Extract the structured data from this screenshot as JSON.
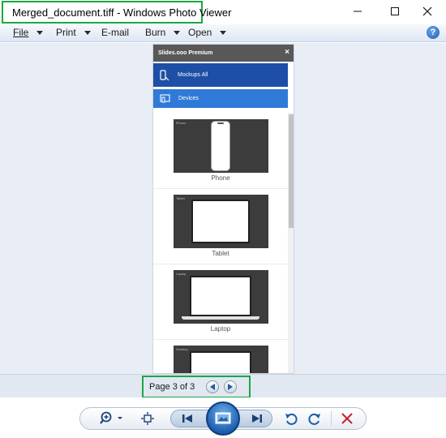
{
  "window": {
    "title": "Merged_document.tiff - Windows Photo Viewer",
    "controls": {
      "minimize_icon": "minimize-icon",
      "maximize_icon": "maximize-icon",
      "close_icon": "close-icon"
    }
  },
  "menu": {
    "items": [
      {
        "label": "File",
        "hotkey_underlined": true,
        "has_dropdown": true
      },
      {
        "label": "Print",
        "hotkey_underlined": true,
        "has_dropdown": true
      },
      {
        "label": "E-mail",
        "hotkey_underlined": true,
        "has_dropdown": false
      },
      {
        "label": "Burn",
        "hotkey_underlined": true,
        "has_dropdown": true
      },
      {
        "label": "Open",
        "hotkey_underlined": true,
        "has_dropdown": true
      }
    ],
    "help_label": "?"
  },
  "document": {
    "header_title": "Slides.ooo Premium",
    "close_label": "×",
    "nav": [
      {
        "label": "Mockups All",
        "icon": "phone-cursor-icon"
      },
      {
        "label": "Devices",
        "icon": "devices-icon"
      }
    ],
    "cards": [
      {
        "label": "Phone",
        "corner_tag": "iPhone"
      },
      {
        "label": "Tablet",
        "corner_tag": "Tablet"
      },
      {
        "label": "Laptop",
        "corner_tag": "Laptop"
      },
      {
        "label": "",
        "corner_tag": "Desktop"
      }
    ]
  },
  "pagination": {
    "text": "Page 3 of 3",
    "current": 3,
    "total": 3
  },
  "toolbar": {
    "buttons": [
      "zoom-icon",
      "actual-size-icon",
      "previous-icon",
      "slideshow-icon",
      "next-icon",
      "rotate-left-icon",
      "rotate-right-icon",
      "delete-icon"
    ]
  },
  "colors": {
    "highlight_border": "#1aa845",
    "nav_dark_blue": "#1e4fa7",
    "nav_light_blue": "#2f7ad8",
    "delete_red": "#c8232c"
  }
}
